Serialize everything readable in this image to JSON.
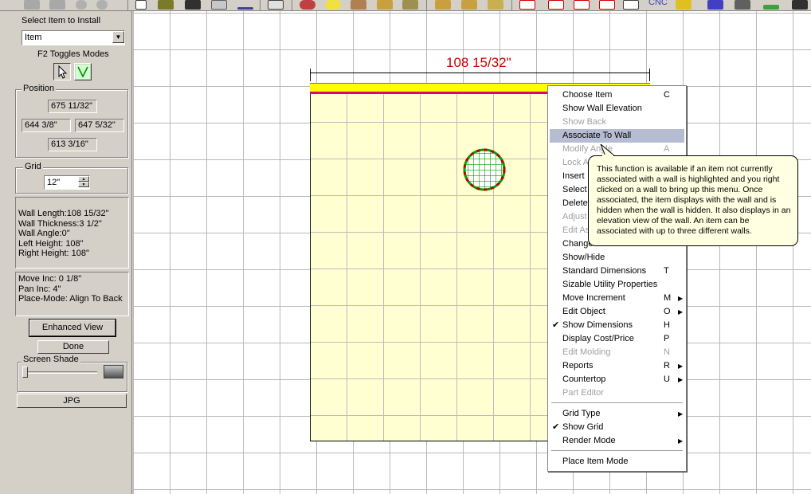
{
  "left_panel": {
    "select_label": "Select Item to Install",
    "item_select": "Item",
    "toggle_label": "F2 Toggles Modes",
    "position": {
      "title": "Position",
      "top": "675 11/32\"",
      "left": "644 3/8\"",
      "right": "647 5/32\"",
      "bottom": "613 3/16\""
    },
    "grid": {
      "title": "Grid",
      "value": "12\""
    },
    "wall_info": [
      "Wall Length:108 15/32\"",
      "Wall Thickness:3 1/2\"",
      "Wall Angle:0\"",
      "Left Height: 108\"",
      "Right Height: 108\""
    ],
    "inc_info": [
      "Move Inc: 0 1/8\"",
      "Pan Inc: 4\"",
      "Place-Mode: Align To Back"
    ],
    "enhanced_view": "Enhanced View",
    "done": "Done",
    "screen_shade": "Screen Shade",
    "jpg": "JPG"
  },
  "toolbar": {
    "cnc_label": "CNC"
  },
  "canvas": {
    "dimension_label": "108 15/32\"",
    "colors": {
      "dimension": "#cc0000",
      "wall": "#ffff00",
      "wall_edge": "#e0007a",
      "room_fill": "#ffffd2",
      "item_green": "#00a000"
    }
  },
  "context_menu": {
    "items": [
      {
        "label": "Choose Item",
        "shortcut": "C",
        "disabled": false
      },
      {
        "label": "Show Wall Elevation",
        "shortcut": "",
        "disabled": false
      },
      {
        "label": "Show Back",
        "shortcut": "",
        "disabled": true
      },
      {
        "label": "Associate To Wall",
        "shortcut": "",
        "disabled": false,
        "highlighted": true
      },
      {
        "label": "Modify Angle",
        "shortcut": "A",
        "disabled": true
      },
      {
        "label": "Lock Angle",
        "shortcut": "",
        "disabled": true
      },
      {
        "label": "Insert",
        "shortcut": "",
        "disabled": false
      },
      {
        "label": "Select",
        "shortcut": "",
        "disabled": false
      },
      {
        "label": "Delete",
        "shortcut": "",
        "disabled": false
      },
      {
        "label": "Adjust",
        "shortcut": "",
        "disabled": true
      },
      {
        "label": "Edit As",
        "shortcut": "",
        "disabled": true
      },
      {
        "label": "Change Material",
        "shortcut": "",
        "disabled": false
      },
      {
        "label": "Show/Hide",
        "shortcut": "",
        "disabled": false
      },
      {
        "label": "Standard Dimensions",
        "shortcut": "T",
        "disabled": false
      },
      {
        "label": "Sizable Utility Properties",
        "shortcut": "",
        "disabled": false
      },
      {
        "label": "Move Increment",
        "shortcut": "M",
        "disabled": false,
        "submenu": true
      },
      {
        "label": "Edit Object",
        "shortcut": "O",
        "disabled": false,
        "submenu": true
      },
      {
        "label": "Show Dimensions",
        "shortcut": "H",
        "disabled": false,
        "checked": true
      },
      {
        "label": "Display Cost/Price",
        "shortcut": "P",
        "disabled": false
      },
      {
        "label": "Edit Molding",
        "shortcut": "N",
        "disabled": true
      },
      {
        "label": "Reports",
        "shortcut": "R",
        "disabled": false,
        "submenu": true
      },
      {
        "label": "Countertop",
        "shortcut": "U",
        "disabled": false,
        "submenu": true
      },
      {
        "label": "Part Editor",
        "shortcut": "",
        "disabled": true
      },
      {
        "label": "Grid Type",
        "shortcut": "",
        "disabled": false,
        "submenu": true
      },
      {
        "label": "Show Grid",
        "shortcut": "",
        "disabled": false,
        "checked": true
      },
      {
        "label": "Render Mode",
        "shortcut": "",
        "disabled": false,
        "submenu": true
      },
      {
        "label": "Place Item Mode",
        "shortcut": "",
        "disabled": false
      }
    ]
  },
  "tooltip": {
    "text": "This function is available if an item not currently associated with a wall is highlighted and you right clicked on a wall to bring up this menu. Once associated, the item displays with the wall and is hidden when the wall is hidden. It also displays in an elevation view of the wall. An item can be associated with up to three different walls."
  }
}
